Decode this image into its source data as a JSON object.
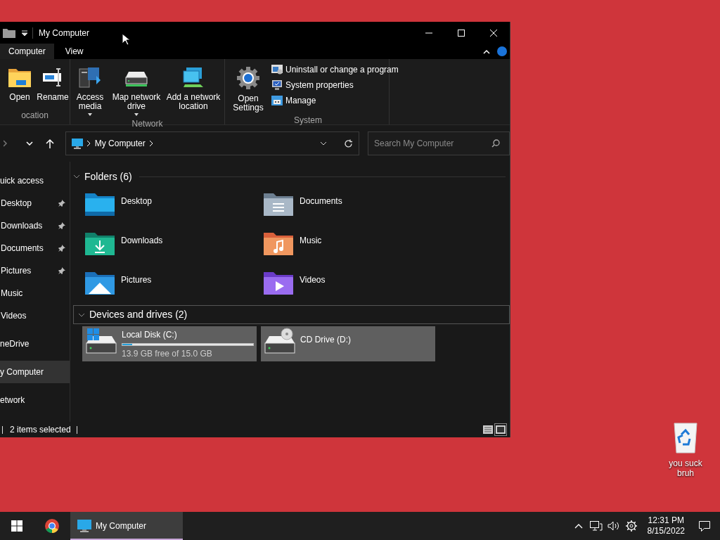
{
  "window": {
    "title": "My Computer"
  },
  "ribbon_tabs": [
    {
      "label": "Computer",
      "selected": true
    },
    {
      "label": "View",
      "selected": false
    }
  ],
  "ribbon_groups": [
    {
      "label": "ocation",
      "buttons": [
        {
          "kind": "open",
          "label": "Open"
        },
        {
          "kind": "rename",
          "label": "Rename"
        }
      ]
    },
    {
      "label": "Network",
      "buttons": [
        {
          "kind": "media",
          "label": "Access media",
          "dropdown": true
        },
        {
          "kind": "drive",
          "label": "Map network drive",
          "dropdown": true
        },
        {
          "kind": "netloc",
          "label": "Add a network location",
          "dropdown": false
        }
      ]
    },
    {
      "label": "System",
      "buttons": [
        {
          "kind": "settings",
          "label": "Open Settings"
        }
      ],
      "small_buttons": [
        {
          "kind": "programs",
          "label": "Uninstall or change a program"
        },
        {
          "kind": "properties",
          "label": "System properties"
        },
        {
          "kind": "manage",
          "label": "Manage"
        }
      ]
    }
  ],
  "address_bar": {
    "path": "My Computer"
  },
  "search": {
    "placeholder": "Search My Computer"
  },
  "sidebar": {
    "items": [
      {
        "label": "uick access",
        "selected": false,
        "children": [
          {
            "label": "Desktop",
            "pinned": true,
            "selected": false
          },
          {
            "label": "Downloads",
            "pinned": true,
            "selected": false
          },
          {
            "label": "Documents",
            "pinned": true,
            "selected": false
          },
          {
            "label": "Pictures",
            "pinned": true,
            "selected": false
          },
          {
            "label": "Music",
            "pinned": false,
            "selected": false
          },
          {
            "label": "Videos",
            "pinned": false,
            "selected": false
          }
        ]
      },
      {
        "label": "neDrive",
        "selected": false
      },
      {
        "label": "y Computer",
        "selected": true
      },
      {
        "label": "etwork",
        "selected": false
      }
    ]
  },
  "folders": {
    "title": "Folders (6)",
    "items": [
      {
        "kind": "desktop",
        "label": "Desktop"
      },
      {
        "kind": "documents",
        "label": "Documents"
      },
      {
        "kind": "downloads",
        "label": "Downloads"
      },
      {
        "kind": "music",
        "label": "Music"
      },
      {
        "kind": "pictures",
        "label": "Pictures"
      },
      {
        "kind": "videos",
        "label": "Videos"
      }
    ]
  },
  "drives": {
    "title": "Devices and drives (2)",
    "items": [
      {
        "kind": "system",
        "label": "Local Disk (C:)",
        "selected": true,
        "level": 0.073,
        "detail": "13.9 GB free of 15.0 GB"
      },
      {
        "kind": "cd",
        "label": "CD Drive (D:)",
        "selected": true
      }
    ]
  },
  "status_bar": {
    "text": "2 items selected",
    "views": [
      {
        "kind": "details",
        "selected": false
      },
      {
        "kind": "large",
        "selected": true
      }
    ]
  },
  "desktop_icons": [
    {
      "label": "you suck bruh"
    }
  ],
  "taskbar": {
    "tasks": [
      {
        "label": "My Computer",
        "selected": true
      }
    ],
    "time": "12:31 PM",
    "date": "8/15/2022"
  }
}
